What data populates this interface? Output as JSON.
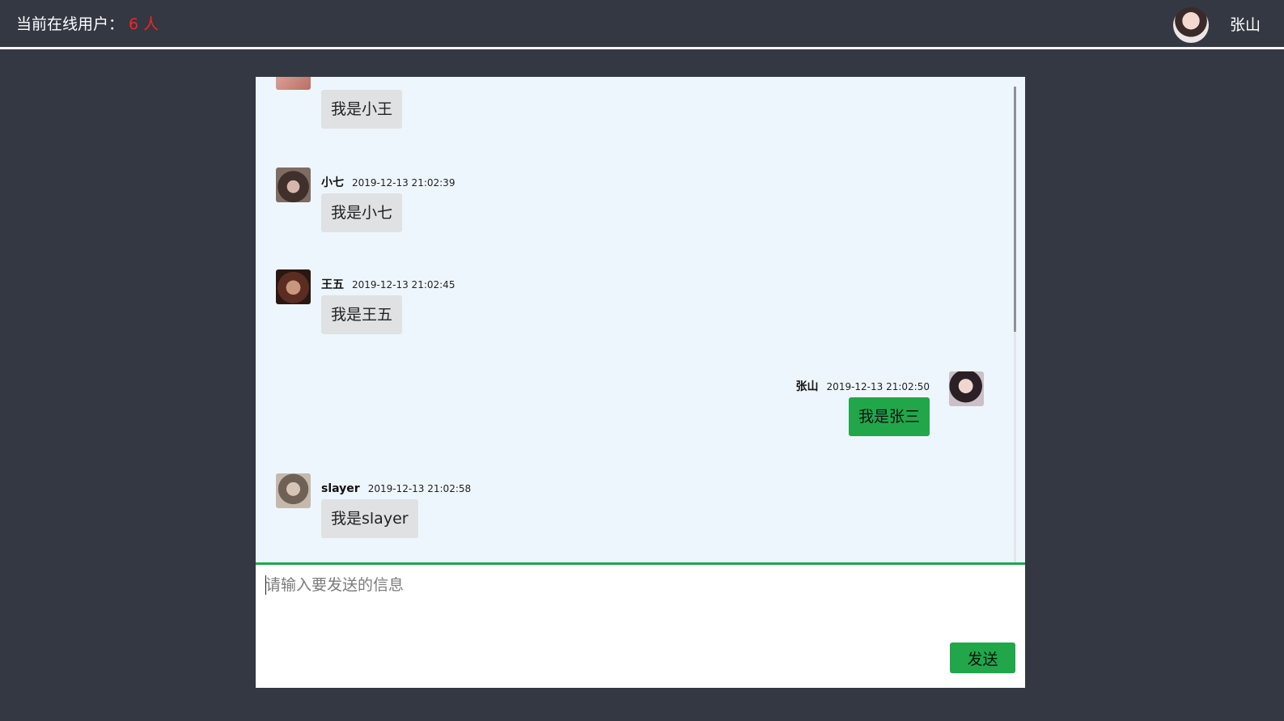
{
  "header": {
    "online_label": "当前在线用户：",
    "online_count": "6 人",
    "user_name": "张山"
  },
  "messages": [
    {
      "side": "left",
      "name": "",
      "time": "",
      "text": "我是小王"
    },
    {
      "side": "left",
      "name": "小七",
      "time": "2019-12-13 21:02:39",
      "text": "我是小七"
    },
    {
      "side": "left",
      "name": "王五",
      "time": "2019-12-13 21:02:45",
      "text": "我是王五"
    },
    {
      "side": "right",
      "name": "张山",
      "time": "2019-12-13 21:02:50",
      "text": "我是张三"
    },
    {
      "side": "left",
      "name": "slayer",
      "time": "2019-12-13 21:02:58",
      "text": "我是slayer"
    }
  ],
  "composer": {
    "placeholder": "请输入要发送的信息",
    "value": "",
    "send_label": "发送"
  },
  "colors": {
    "background": "#343842",
    "chat_background": "#eef6fd",
    "accent_green": "#21a74a",
    "online_count_red": "#ff2020",
    "bubble_gray": "#dfe1e3"
  }
}
